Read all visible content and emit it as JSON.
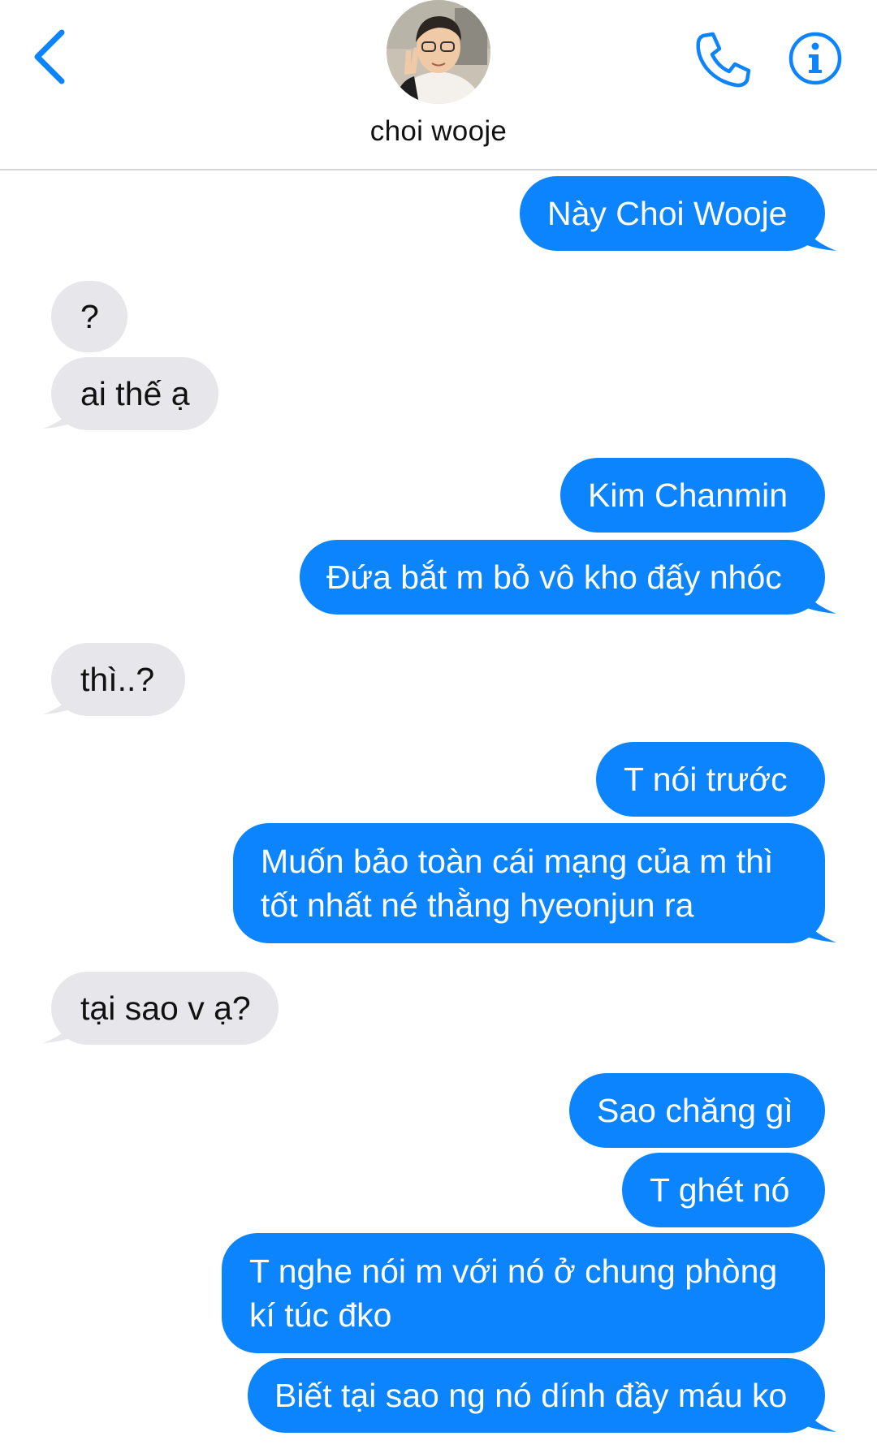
{
  "header": {
    "contact_name": "choi wooje",
    "back_icon": "chevron-left-icon",
    "call_icon": "phone-icon",
    "info_icon": "info-icon",
    "accent_color": "#0b84fe"
  },
  "colors": {
    "sent_bubble": "#0b84fe",
    "received_bubble": "#e6e6eb"
  },
  "messages": [
    {
      "from": "me",
      "text": "Này Choi Wooje"
    },
    {
      "from": "them",
      "text": "?"
    },
    {
      "from": "them",
      "text": "ai thế ạ"
    },
    {
      "from": "me",
      "text": "Kim Chanmin"
    },
    {
      "from": "me",
      "text": "Đứa bắt m bỏ vô kho đấy nhóc"
    },
    {
      "from": "them",
      "text": "thì..?"
    },
    {
      "from": "me",
      "text": "T nói trước"
    },
    {
      "from": "me",
      "text": "Muốn bảo toàn cái mạng của m thì tốt nhất né thằng hyeonjun ra"
    },
    {
      "from": "them",
      "text": "tại sao v ạ?"
    },
    {
      "from": "me",
      "text": "Sao chăng gì"
    },
    {
      "from": "me",
      "text": "T ghét nó"
    },
    {
      "from": "me",
      "text": "T nghe nói m với nó ở chung phòng kí túc đko"
    },
    {
      "from": "me",
      "text": "Biết tại sao ng nó dính đầy máu ko"
    }
  ]
}
